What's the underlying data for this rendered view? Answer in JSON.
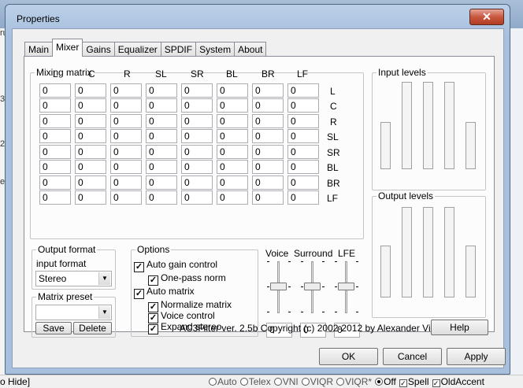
{
  "window": {
    "title": "Properties",
    "close_glyph": "✕"
  },
  "background": {
    "left_snippets": [
      "ru",
      "3",
      "22",
      "er."
    ],
    "status_left": "o Hide]",
    "status_options": [
      {
        "label": "Auto",
        "type": "radio",
        "on": false
      },
      {
        "label": "Telex",
        "type": "radio",
        "on": false
      },
      {
        "label": "VNI",
        "type": "radio",
        "on": false
      },
      {
        "label": "VIQR",
        "type": "radio",
        "on": false
      },
      {
        "label": "VIQR*",
        "type": "radio",
        "on": false
      },
      {
        "label": "Off",
        "type": "radio",
        "on": true
      },
      {
        "label": "Spell",
        "type": "check",
        "on": true
      },
      {
        "label": "OldAccent",
        "type": "check",
        "on": true
      }
    ]
  },
  "tabs": [
    "Main",
    "Mixer",
    "Gains",
    "Equalizer",
    "SPDIF",
    "System",
    "About"
  ],
  "active_tab": "Mixer",
  "mixing_matrix": {
    "title": "Mixing matrix",
    "columns": [
      "L",
      "C",
      "R",
      "SL",
      "SR",
      "BL",
      "BR",
      "LF"
    ],
    "rows": [
      "L",
      "C",
      "R",
      "SL",
      "SR",
      "BL",
      "BR",
      "LF"
    ],
    "values": [
      [
        "0",
        "0",
        "0",
        "0",
        "0",
        "0",
        "0",
        "0"
      ],
      [
        "0",
        "0",
        "0",
        "0",
        "0",
        "0",
        "0",
        "0"
      ],
      [
        "0",
        "0",
        "0",
        "0",
        "0",
        "0",
        "0",
        "0"
      ],
      [
        "0",
        "0",
        "0",
        "0",
        "0",
        "0",
        "0",
        "0"
      ],
      [
        "0",
        "0",
        "0",
        "0",
        "0",
        "0",
        "0",
        "0"
      ],
      [
        "0",
        "0",
        "0",
        "0",
        "0",
        "0",
        "0",
        "0"
      ],
      [
        "0",
        "0",
        "0",
        "0",
        "0",
        "0",
        "0",
        "0"
      ],
      [
        "0",
        "0",
        "0",
        "0",
        "0",
        "0",
        "0",
        "0"
      ]
    ]
  },
  "input_levels": {
    "title": "Input levels"
  },
  "output_levels": {
    "title": "Output levels"
  },
  "output_format": {
    "title": "Output format",
    "input_format_label": "input format",
    "selected": "Stereo"
  },
  "matrix_preset": {
    "title": "Matrix preset",
    "selected": "",
    "save_label": "Save",
    "delete_label": "Delete"
  },
  "options": {
    "title": "Options",
    "items": [
      {
        "label": "Auto gain control",
        "checked": true
      },
      {
        "label": "One-pass norm",
        "checked": true
      },
      {
        "label": "Auto matrix",
        "checked": true
      },
      {
        "label": "Normalize matrix",
        "checked": true
      },
      {
        "label": "Voice control",
        "checked": true
      },
      {
        "label": "Expand stereo",
        "checked": true
      }
    ]
  },
  "sliders": {
    "labels": [
      "Voice",
      "Surround",
      "LFE"
    ],
    "values": [
      "0",
      "0",
      "0"
    ]
  },
  "copyright": "AC3Filter ver. 2.5b Copyright (c) 2002-2012 by Alexander Vigovsky",
  "help_label": "Help",
  "buttons": {
    "ok": "OK",
    "cancel": "Cancel",
    "apply": "Apply"
  }
}
